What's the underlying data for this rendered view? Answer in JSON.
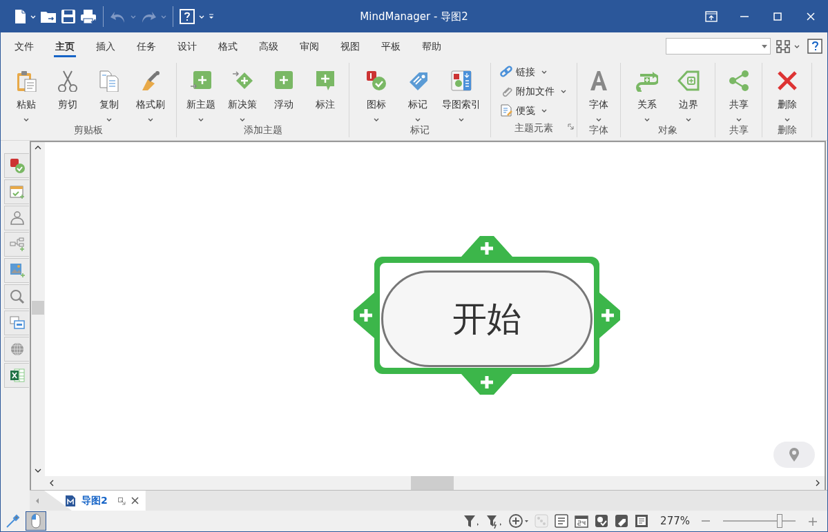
{
  "window": {
    "title": "MindManager - 导图2"
  },
  "quick_access": {
    "undo": {
      "disabled": true
    },
    "redo": {
      "disabled": true
    }
  },
  "menu_tabs": [
    {
      "label": "文件",
      "selected": false
    },
    {
      "label": "主页",
      "selected": true
    },
    {
      "label": "插入",
      "selected": false
    },
    {
      "label": "任务",
      "selected": false
    },
    {
      "label": "设计",
      "selected": false
    },
    {
      "label": "格式",
      "selected": false
    },
    {
      "label": "高级",
      "selected": false
    },
    {
      "label": "审阅",
      "selected": false
    },
    {
      "label": "视图",
      "selected": false
    },
    {
      "label": "平板",
      "selected": false
    },
    {
      "label": "帮助",
      "selected": false
    }
  ],
  "ribbon": [
    {
      "label": "剪贴板",
      "kind": "large",
      "buttons": [
        {
          "label": "粘贴",
          "kind": "paste",
          "has_menu": true
        },
        {
          "label": "剪切",
          "kind": "cut",
          "has_menu": false
        },
        {
          "label": "复制",
          "kind": "copy",
          "has_menu": true
        },
        {
          "label": "格式刷",
          "kind": "brush",
          "has_menu": true
        }
      ]
    },
    {
      "label": "添加主题",
      "kind": "large",
      "buttons": [
        {
          "label": "新主题",
          "kind": "topic",
          "has_menu": true
        },
        {
          "label": "新决策",
          "kind": "decision",
          "has_menu": true
        },
        {
          "label": "浮动",
          "kind": "floating",
          "has_menu": false
        },
        {
          "label": "标注",
          "kind": "callout",
          "has_menu": false
        }
      ]
    },
    {
      "label": "标记",
      "kind": "large",
      "buttons": [
        {
          "label": "图标",
          "kind": "icons",
          "has_menu": true
        },
        {
          "label": "标记",
          "kind": "tag",
          "has_menu": true
        },
        {
          "label": "导图索引",
          "kind": "index",
          "has_menu": true
        }
      ]
    },
    {
      "label": "主题元素",
      "kind": "small",
      "launcher": true,
      "buttons": [
        {
          "label": "链接",
          "kind": "link",
          "has_menu": true
        },
        {
          "label": "附加文件",
          "kind": "attach",
          "has_menu": true
        },
        {
          "label": "便笺",
          "kind": "note",
          "has_menu": true
        }
      ]
    },
    {
      "label": "字体",
      "kind": "large",
      "buttons": [
        {
          "label": "字体",
          "kind": "font",
          "has_menu": true
        }
      ]
    },
    {
      "label": "对象",
      "kind": "large",
      "buttons": [
        {
          "label": "关系",
          "kind": "relation",
          "has_menu": true
        },
        {
          "label": "边界",
          "kind": "boundary",
          "has_menu": true
        }
      ]
    },
    {
      "label": "共享",
      "kind": "large",
      "buttons": [
        {
          "label": "共享",
          "kind": "share",
          "has_menu": true
        }
      ]
    },
    {
      "label": "删除",
      "kind": "large",
      "buttons": [
        {
          "label": "删除",
          "kind": "delete",
          "has_menu": true
        }
      ]
    }
  ],
  "canvas": {
    "central_topic": {
      "text": "开始"
    }
  },
  "doc_tabs": [
    {
      "label": "导图2",
      "selected": true
    }
  ],
  "status_bar": {
    "zoom": "277%",
    "zoom_slider": {
      "level": 0.78
    }
  }
}
